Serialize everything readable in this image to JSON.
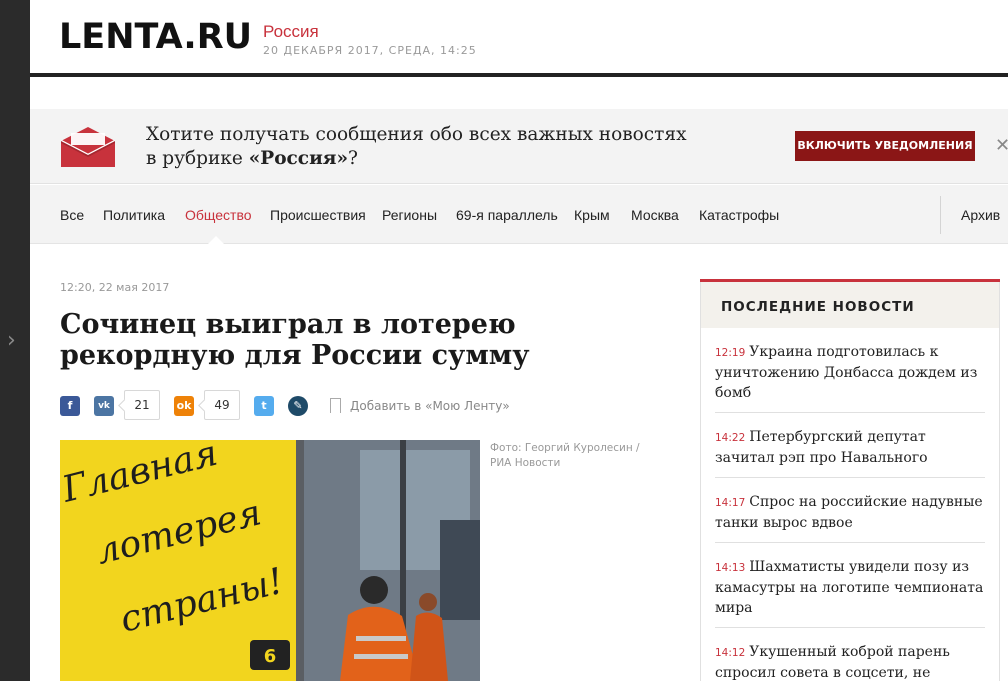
{
  "site": {
    "logo": "LENTA.RU",
    "rubric": "Россия",
    "date": "20 ДЕКАБРЯ 2017, СРЕДА, 14:25"
  },
  "notify": {
    "text_line1": "Хотите получать сообщения обо всех важных новостях",
    "text_prefix": "в рубрике ",
    "text_rubric": "«Россия»",
    "text_suffix": "?",
    "button_label": "ВКЛЮЧИТЬ УВЕДОМЛЕНИЯ",
    "close": "✕"
  },
  "nav": {
    "items": [
      "Все",
      "Политика",
      "Общество",
      "Происшествия",
      "Регионы",
      "69-я параллель",
      "Крым",
      "Москва",
      "Катастрофы"
    ],
    "active": "Общество",
    "archive": "Архив"
  },
  "article": {
    "date": "12:20, 22 мая 2017",
    "title": "Сочинец выиграл в лотерею рекордную для России сумму",
    "share": {
      "vk_count": "21",
      "ok_count": "49",
      "add_label": "Добавить в «Мою Ленту»"
    },
    "photo_credit_line1": "Фото: Георгий Куролесин /",
    "photo_credit_line2": "РИА Новости",
    "photo_sign": "Главная лотерея страны!"
  },
  "sidebar": {
    "title": "ПОСЛЕДНИЕ НОВОСТИ",
    "news": [
      {
        "time": "12:19",
        "text": "Украина подготовилась к уничтожению Донбасса дождем из бомб"
      },
      {
        "time": "14:22",
        "text": "Петербургский депутат зачитал рэп про Навального"
      },
      {
        "time": "14:17",
        "text": "Спрос на российские надувные танки вырос вдвое"
      },
      {
        "time": "14:13",
        "text": "Шахматисты увидели позу из камасутры на логотипе чемпионата мира"
      },
      {
        "time": "14:12",
        "text": "Укушенный коброй парень спросил совета в соцсети, не дождался"
      }
    ]
  },
  "colors": {
    "accent": "#c8323c",
    "button": "#8b1616",
    "rail": "#2b2b2b"
  }
}
